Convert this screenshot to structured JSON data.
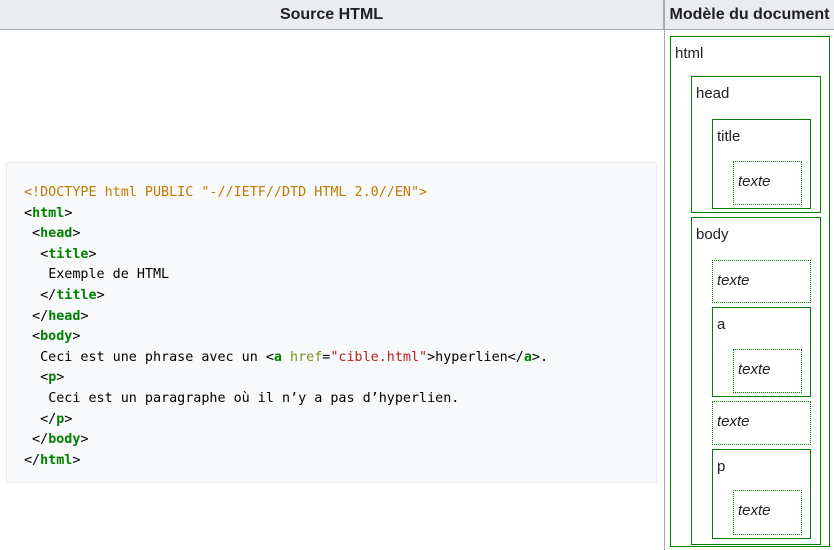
{
  "headers": {
    "source": "Source HTML",
    "model": "Modèle du document"
  },
  "code": {
    "doctype": "<!DOCTYPE html PUBLIC \"-//IETF//DTD HTML 2.0//EN\">",
    "html_open": "html",
    "head_open": "head",
    "title_open": "title",
    "title_text": "Exemple de HTML",
    "title_close": "title",
    "head_close": "head",
    "body_open": "body",
    "sentence_start": "Ceci est une phrase avec un ",
    "a_tag": "a",
    "href_attr": "href",
    "href_value": "\"cible.html\"",
    "link_text": "hyperlien",
    "a_close": "a",
    "sentence_end": ".",
    "p_open": "p",
    "p_text": "Ceci est un paragraphe où il n’y a pas d’hyperlien.",
    "p_close": "p",
    "body_close": "body",
    "html_close": "html"
  },
  "model": {
    "html": "html",
    "head": "head",
    "title": "title",
    "title_text": "texte",
    "body": "body",
    "body_text1": "texte",
    "a": "a",
    "a_text": "texte",
    "body_text2": "texte",
    "p": "p",
    "p_text": "texte"
  }
}
